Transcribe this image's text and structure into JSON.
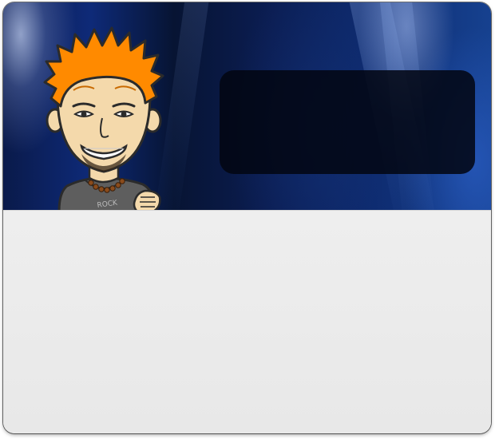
{
  "window": {
    "banner": {
      "colors": {
        "deep": "#071433",
        "mid": "#0e2a78",
        "light": "#16418f"
      },
      "avatar": {
        "icon": "cartoon-avatar-icon",
        "hair_color": "#ff8a00",
        "shirt_text": "ROCK"
      }
    },
    "info_panel": {},
    "content_area": {
      "background": "#ececec"
    }
  }
}
